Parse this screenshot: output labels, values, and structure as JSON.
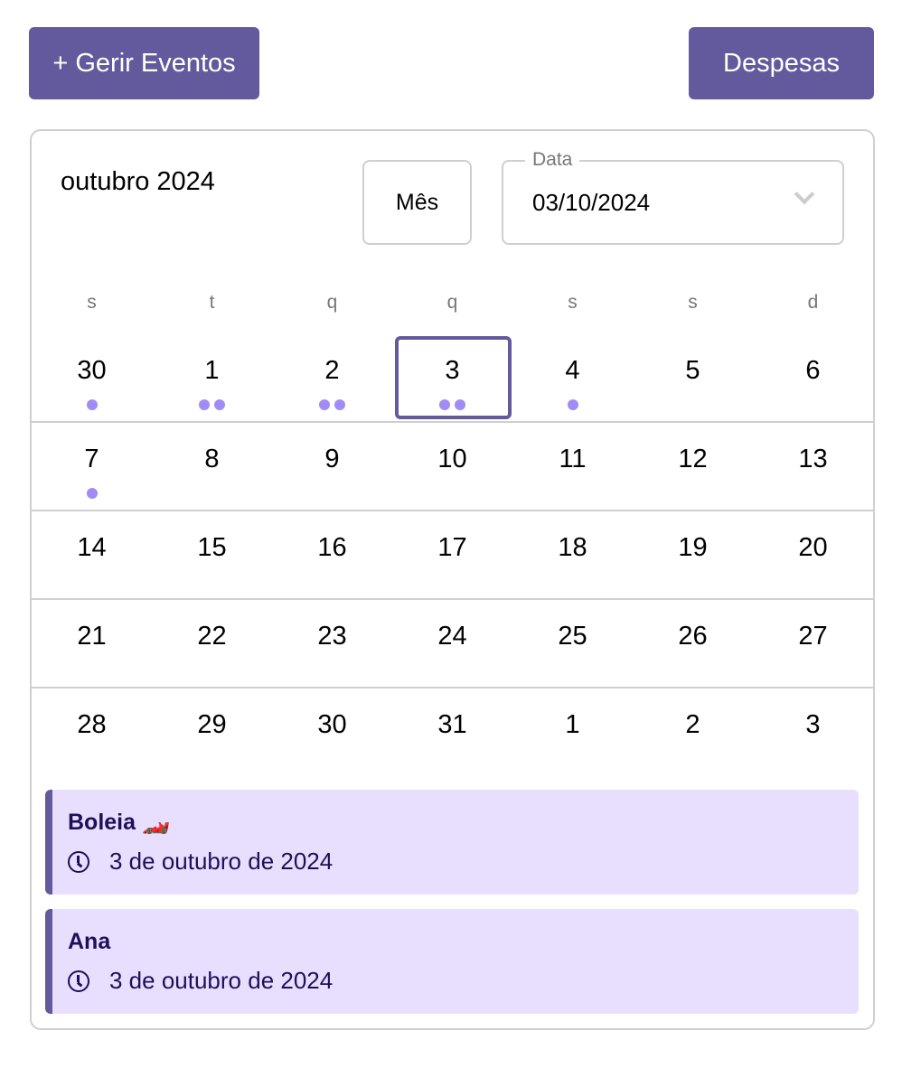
{
  "toolbar": {
    "manage_events": "+ Gerir Eventos",
    "expenses": "Despesas"
  },
  "calendar": {
    "title": "outubro 2024",
    "view_button": "Mês",
    "date_field": {
      "label": "Data",
      "value": "03/10/2024"
    },
    "weekdays": [
      "s",
      "t",
      "q",
      "q",
      "s",
      "s",
      "d"
    ],
    "selected": "3",
    "weeks": [
      [
        {
          "d": "30",
          "dots": 1
        },
        {
          "d": "1",
          "dots": 2
        },
        {
          "d": "2",
          "dots": 2
        },
        {
          "d": "3",
          "dots": 2,
          "sel": true
        },
        {
          "d": "4",
          "dots": 1
        },
        {
          "d": "5",
          "dots": 0
        },
        {
          "d": "6",
          "dots": 0
        }
      ],
      [
        {
          "d": "7",
          "dots": 1
        },
        {
          "d": "8",
          "dots": 0
        },
        {
          "d": "9",
          "dots": 0
        },
        {
          "d": "10",
          "dots": 0
        },
        {
          "d": "11",
          "dots": 0
        },
        {
          "d": "12",
          "dots": 0
        },
        {
          "d": "13",
          "dots": 0
        }
      ],
      [
        {
          "d": "14",
          "dots": 0
        },
        {
          "d": "15",
          "dots": 0
        },
        {
          "d": "16",
          "dots": 0
        },
        {
          "d": "17",
          "dots": 0
        },
        {
          "d": "18",
          "dots": 0
        },
        {
          "d": "19",
          "dots": 0
        },
        {
          "d": "20",
          "dots": 0
        }
      ],
      [
        {
          "d": "21",
          "dots": 0
        },
        {
          "d": "22",
          "dots": 0
        },
        {
          "d": "23",
          "dots": 0
        },
        {
          "d": "24",
          "dots": 0
        },
        {
          "d": "25",
          "dots": 0
        },
        {
          "d": "26",
          "dots": 0
        },
        {
          "d": "27",
          "dots": 0
        }
      ],
      [
        {
          "d": "28",
          "dots": 0
        },
        {
          "d": "29",
          "dots": 0
        },
        {
          "d": "30",
          "dots": 0
        },
        {
          "d": "31",
          "dots": 0
        },
        {
          "d": "1",
          "dots": 0
        },
        {
          "d": "2",
          "dots": 0
        },
        {
          "d": "3",
          "dots": 0
        }
      ]
    ]
  },
  "events": [
    {
      "name": "Boleia 🏎️",
      "date": "3 de outubro de 2024"
    },
    {
      "name": "Ana",
      "date": "3 de outubro de 2024"
    }
  ],
  "colors": {
    "accent": "#635a9e",
    "dot": "#a08cf4",
    "event_bg": "#e8defd"
  }
}
